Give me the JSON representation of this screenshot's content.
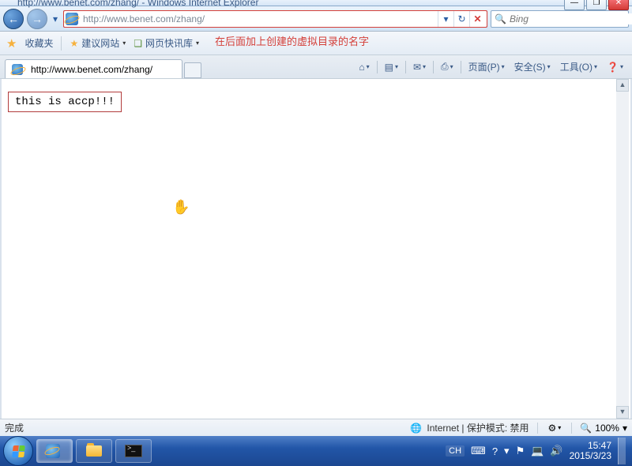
{
  "window": {
    "title": "http://www.benet.com/zhang/ - Windows Internet Explorer",
    "controls": {
      "min": "—",
      "max": "❐",
      "close": "✕"
    }
  },
  "nav": {
    "back": "←",
    "fwd": "→",
    "drop": "▾",
    "url": "http://www.benet.com/zhang/",
    "refresh": "↻",
    "stop": "✕",
    "search_icon": "🔍",
    "search_placeholder": "Bing"
  },
  "annotation": "在后面加上创建的虚拟目录的名字",
  "favbar": {
    "star": "★",
    "label": "收藏夹",
    "items": [
      {
        "icon": "★",
        "label": "建议网站",
        "dd": "▾"
      },
      {
        "icon": "❏",
        "label": "网页快讯库",
        "dd": "▾"
      }
    ]
  },
  "tab": {
    "title": "http://www.benet.com/zhang/"
  },
  "toolbar": {
    "home": "⌂",
    "rss": "▤",
    "mail": "✉",
    "print": "⎙",
    "page": "页面(P)",
    "safety": "安全(S)",
    "tools": "工具(O)",
    "help": "❓",
    "dd": "▾"
  },
  "page": {
    "content": "this is accp!!!",
    "cursor": "↖"
  },
  "scrollbar": {
    "up": "▲",
    "down": "▼"
  },
  "status": {
    "done": "完成",
    "globe": "🌐",
    "zone": "Internet | 保护模式: 禁用",
    "protect_icon": "⚙",
    "protect_dd": "▾",
    "zoom_icon": "🔍",
    "zoom": "100%",
    "zoom_dd": "▾"
  },
  "taskbar": {
    "cmd_prompt": ">_",
    "tray": {
      "lang": "CH",
      "kb": "⌨",
      "help": "?",
      "down": "▾",
      "flag": "⚑",
      "net": "💻",
      "vol": "🔊",
      "time": "15:47",
      "date": "2015/3/23"
    }
  }
}
